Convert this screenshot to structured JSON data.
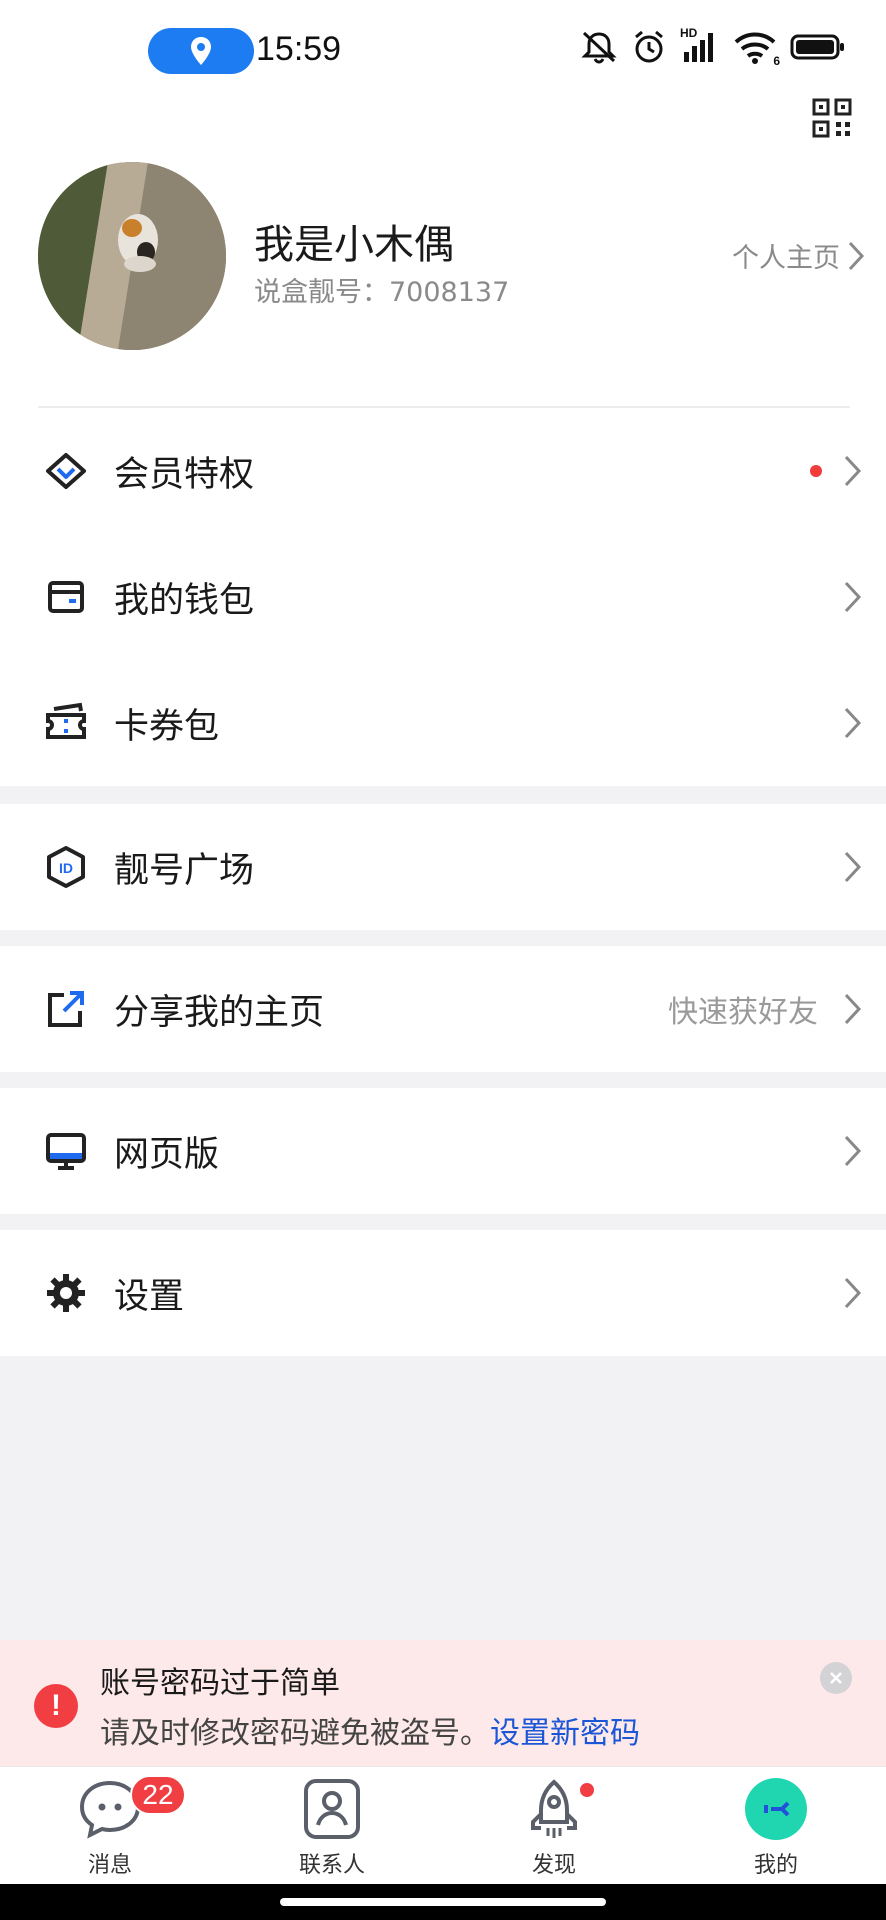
{
  "status_bar": {
    "time": "15:59",
    "icons": [
      "location-icon",
      "mute-icon",
      "alarm-icon",
      "signal-icon",
      "wifi-icon",
      "battery-icon"
    ],
    "hd_label": "HD",
    "wifi_label": "6"
  },
  "header": {
    "qr_icon": "qr-code-icon"
  },
  "profile": {
    "name": "我是小木偶",
    "handle": "说盒靓号：7008137",
    "homepage_link": "个人主页"
  },
  "menu": {
    "vip": {
      "label": "会员特权",
      "icon": "diamond-icon",
      "has_dot": true
    },
    "wallet": {
      "label": "我的钱包",
      "icon": "wallet-icon"
    },
    "coupons": {
      "label": "卡券包",
      "icon": "ticket-icon"
    },
    "number_plaza": {
      "label": "靓号广场",
      "icon": "id-badge-icon"
    },
    "share": {
      "label": "分享我的主页",
      "icon": "share-icon",
      "hint": "快速获好友"
    },
    "web": {
      "label": "网页版",
      "icon": "monitor-icon"
    },
    "settings": {
      "label": "设置",
      "icon": "gear-icon"
    }
  },
  "warning": {
    "title": "账号密码过于简单",
    "body": "请及时修改密码避免被盗号。",
    "link": "设置新密码",
    "icon_glyph": "!"
  },
  "tabbar": {
    "messages": {
      "label": "消息",
      "badge": "22"
    },
    "contacts": {
      "label": "联系人"
    },
    "discover": {
      "label": "发现",
      "has_dot": true
    },
    "me": {
      "label": "我的",
      "active": true
    }
  },
  "colors": {
    "accent_blue": "#1e7cf2",
    "link_blue": "#1a56d6",
    "alert_red": "#f03e43",
    "warning_bg": "#fde9ea",
    "me_tab": "#1fd6b0"
  }
}
